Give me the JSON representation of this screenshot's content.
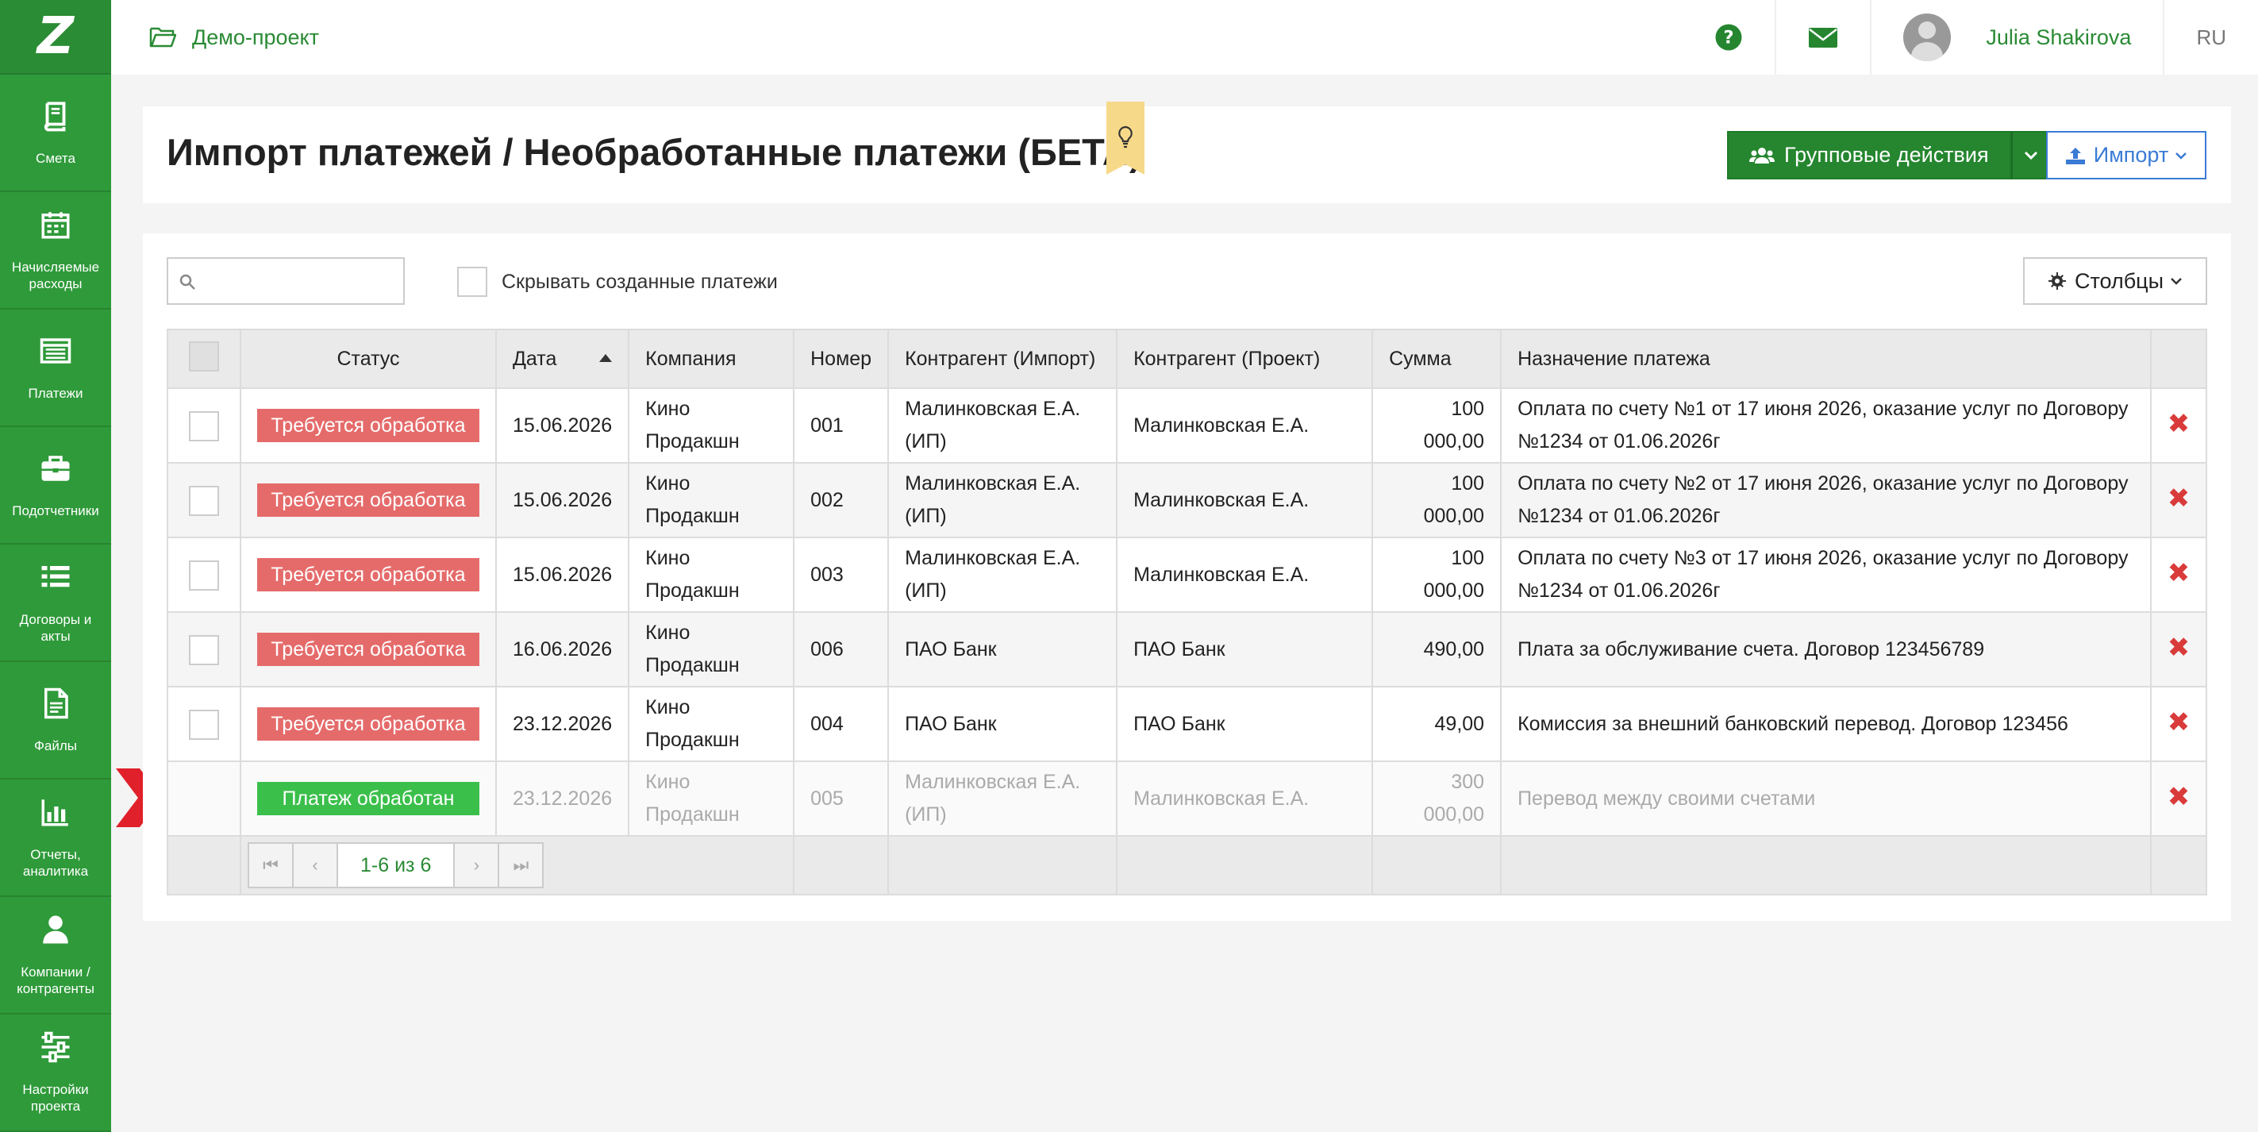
{
  "sidebar": {
    "logo": "Z",
    "items": [
      {
        "label": "Смета"
      },
      {
        "label": "Начисляемые расходы"
      },
      {
        "label": "Платежи"
      },
      {
        "label": "Подотчетники"
      },
      {
        "label": "Договоры и акты"
      },
      {
        "label": "Файлы"
      },
      {
        "label": "Отчеты, аналитика"
      },
      {
        "label": "Компании / контрагенты"
      },
      {
        "label": "Настройки проекта"
      }
    ]
  },
  "topbar": {
    "project_name": "Демо-проект",
    "user_name": "Julia Shakirova",
    "lang": "RU"
  },
  "header": {
    "title": "Импорт платежей / Необработанные платежи (БЕТА)",
    "group_actions_label": "Групповые действия",
    "import_label": "Импорт"
  },
  "toolbar": {
    "search_placeholder": "",
    "hide_created_label": "Скрывать созданные платежи",
    "columns_label": "Столбцы"
  },
  "table": {
    "headers": {
      "status": "Статус",
      "date": "Дата",
      "company": "Компания",
      "number": "Номер",
      "counterparty_import": "Контрагент (Импорт)",
      "counterparty_project": "Контрагент (Проект)",
      "amount": "Сумма",
      "purpose": "Назначение платежа"
    },
    "rows": [
      {
        "status": "Требуется обработка",
        "date": "15.06.2026",
        "company": "Кино Продакшн",
        "number": "001",
        "cp_import": "Малинковская Е.А. (ИП)",
        "cp_project": "Малинковская Е.А.",
        "amount": "100 000,00",
        "purpose": "Оплата по счету №1 от 17 июня 2026, оказание услуг по Договору №1234 от 01.06.2026г"
      },
      {
        "status": "Требуется обработка",
        "date": "15.06.2026",
        "company": "Кино Продакшн",
        "number": "002",
        "cp_import": "Малинковская Е.А. (ИП)",
        "cp_project": "Малинковская Е.А.",
        "amount": "100 000,00",
        "purpose": "Оплата по счету №2 от 17 июня 2026, оказание услуг по Договору №1234 от 01.06.2026г"
      },
      {
        "status": "Требуется обработка",
        "date": "15.06.2026",
        "company": "Кино Продакшн",
        "number": "003",
        "cp_import": "Малинковская Е.А. (ИП)",
        "cp_project": "Малинковская Е.А.",
        "amount": "100 000,00",
        "purpose": "Оплата по счету №3 от 17 июня 2026, оказание услуг по Договору №1234 от 01.06.2026г"
      },
      {
        "status": "Требуется обработка",
        "date": "16.06.2026",
        "company": "Кино Продакшн",
        "number": "006",
        "cp_import": "ПАО Банк",
        "cp_project": "ПАО Банк",
        "amount": "490,00",
        "purpose": "Плата за обслуживание счета. Договор 123456789"
      },
      {
        "status": "Требуется обработка",
        "date": "23.12.2026",
        "company": "Кино Продакшн",
        "number": "004",
        "cp_import": "ПАО Банк",
        "cp_project": "ПАО Банк",
        "amount": "49,00",
        "purpose": "Комиссия за внешний банковский перевод. Договор 123456"
      },
      {
        "status": "Платеж обработан",
        "date": "23.12.2026",
        "company": "Кино Продакшн",
        "number": "005",
        "cp_import": "Малинковская Е.А. (ИП)",
        "cp_project": "Малинковская Е.А.",
        "amount": "300 000,00",
        "purpose": "Перевод между своими счетами"
      }
    ],
    "pager_info": "1-6 из 6"
  },
  "colors": {
    "sidebar": "#2f9a3a",
    "accent_green": "#25862f",
    "status_pending": "#e56b6b",
    "status_done": "#3bbf4b",
    "delete": "#d93b3b",
    "import_blue": "#3a7bd5"
  }
}
